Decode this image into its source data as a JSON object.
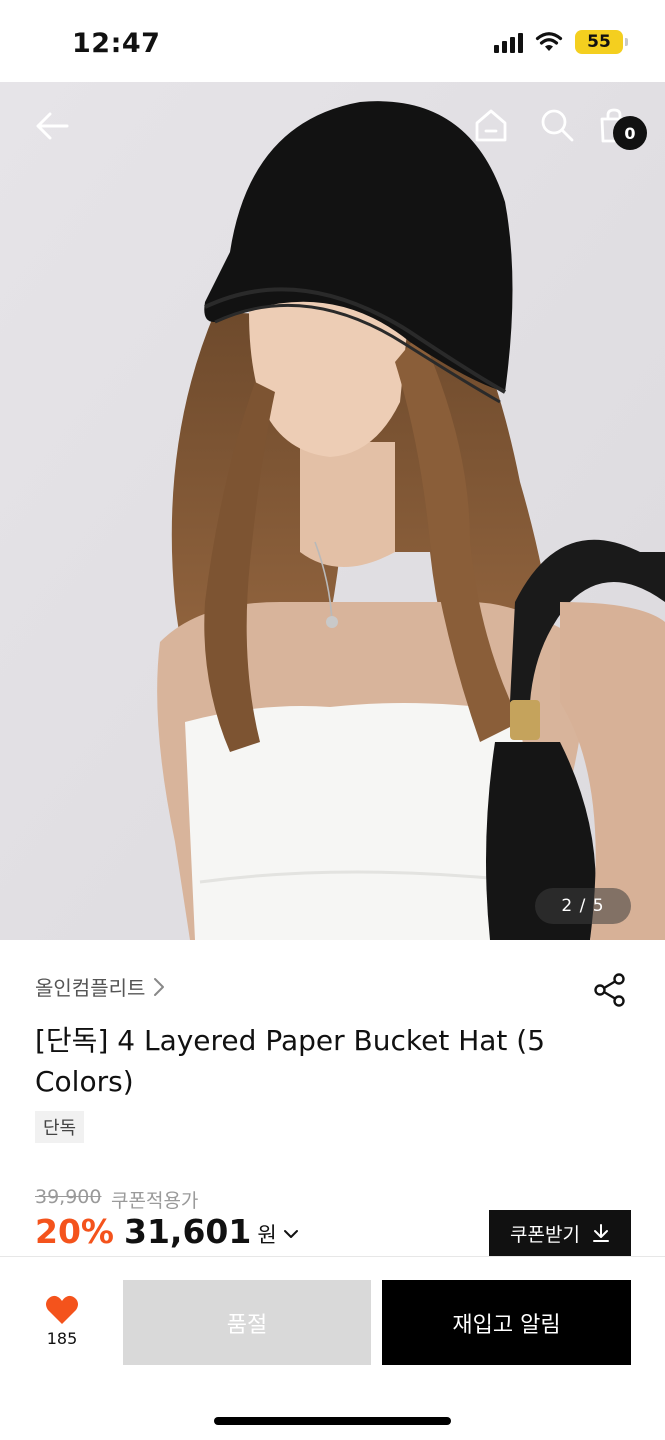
{
  "status_bar": {
    "time": "12:47",
    "battery": "55"
  },
  "hero": {
    "page_counter": "2 / 5",
    "cart_count": "0"
  },
  "product": {
    "brand": "올인컴플리트",
    "title": "[단독] 4 Layered Paper Bucket Hat (5 Colors)",
    "tag": "단독",
    "original_price": "39,900",
    "price_note": "쿠폰적용가",
    "discount": "20%",
    "price": "31,601",
    "currency": "원",
    "coupon_button": "쿠폰받기"
  },
  "bottom_bar": {
    "like_count": "185",
    "soldout_button": "품절",
    "restock_button": "재입고 알림"
  },
  "colors": {
    "accent": "#f4531c",
    "heart": "#f4531c",
    "battery": "#f4cf1f",
    "primary": "#000000"
  },
  "icons": [
    "back-arrow-icon",
    "home-icon",
    "search-icon",
    "shopping-bag-icon",
    "share-icon",
    "chevron-right-icon",
    "chevron-down-icon",
    "download-icon",
    "heart-icon",
    "wifi-icon",
    "signal-icon"
  ]
}
